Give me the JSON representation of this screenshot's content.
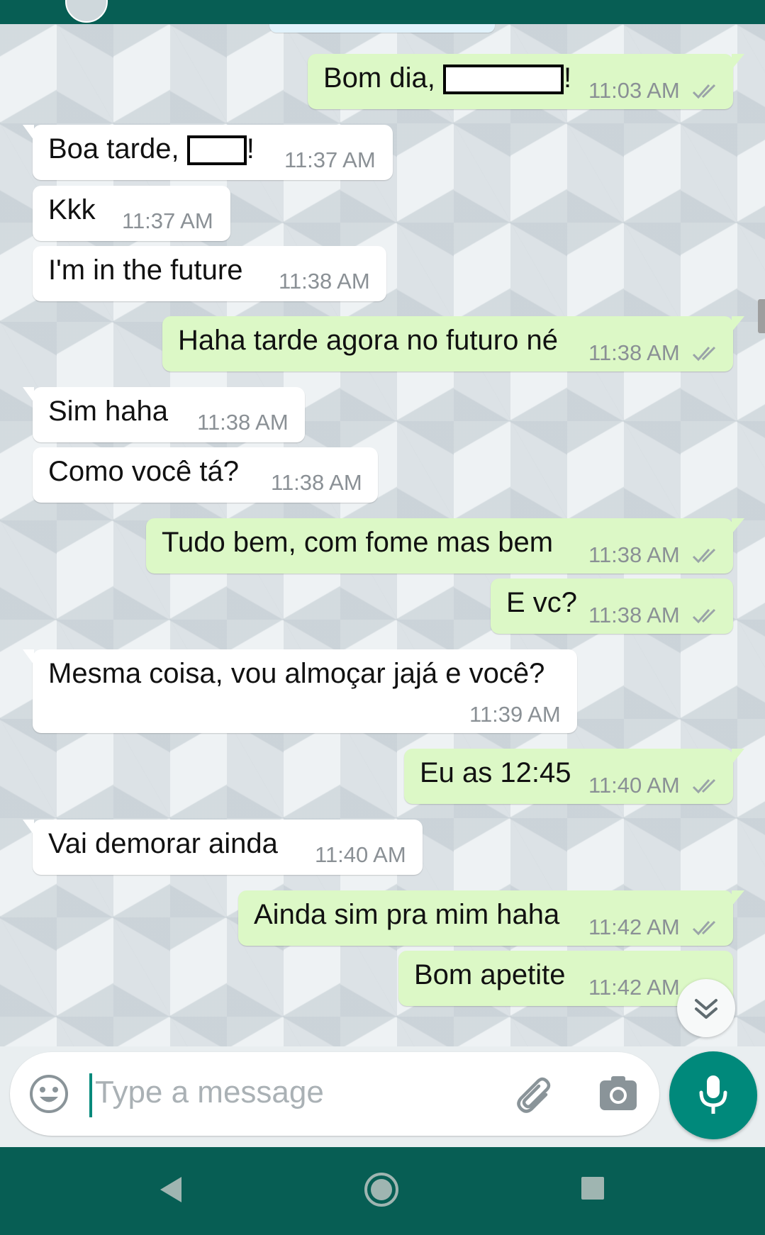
{
  "composer": {
    "placeholder": "Type a message",
    "icons": [
      "emoji-icon",
      "paperclip-icon",
      "camera-icon"
    ]
  },
  "mic_button": {
    "icon": "mic-icon"
  },
  "scroll_button": {
    "icon": "double-chevron-down-icon"
  },
  "navigation": {
    "icons": [
      "back-triangle-icon",
      "home-circle-icon",
      "recents-square-icon"
    ]
  },
  "colors": {
    "header": "#075e54",
    "outgoing_bubble": "#dcf8c6",
    "incoming_bubble": "#ffffff",
    "accent": "#00897b",
    "time_text": "#8a9095",
    "read_ticks": "#9aa3a8"
  },
  "messages": [
    {
      "direction": "out",
      "text": "Bom dia,",
      "suffix": "!",
      "redacted": true,
      "time": "11:03 AM",
      "status": "read"
    },
    {
      "direction": "in",
      "text": "Boa tarde,",
      "suffix": "!",
      "redacted": true,
      "time": "11:37 AM"
    },
    {
      "direction": "in",
      "text": "Kkk",
      "time": "11:37 AM"
    },
    {
      "direction": "in",
      "text": "I'm in the future",
      "time": "11:38 AM"
    },
    {
      "direction": "out",
      "text": "Haha tarde agora no futuro né",
      "time": "11:38 AM",
      "status": "read"
    },
    {
      "direction": "in",
      "text": "Sim haha",
      "time": "11:38 AM"
    },
    {
      "direction": "in",
      "text": "Como você tá?",
      "time": "11:38 AM"
    },
    {
      "direction": "out",
      "text": "Tudo bem, com fome mas bem",
      "time": "11:38 AM",
      "status": "read"
    },
    {
      "direction": "out",
      "text": "E vc?",
      "time": "11:38 AM",
      "status": "read"
    },
    {
      "direction": "in",
      "text": "Mesma coisa, vou almoçar jajá e você?",
      "time": "11:39 AM"
    },
    {
      "direction": "out",
      "text": "Eu as 12:45",
      "time": "11:40 AM",
      "status": "read"
    },
    {
      "direction": "in",
      "text": "Vai demorar ainda",
      "time": "11:40 AM"
    },
    {
      "direction": "out",
      "text": "Ainda sim pra mim haha",
      "time": "11:42 AM",
      "status": "read"
    },
    {
      "direction": "out",
      "text": "Bom apetite",
      "time": "11:42 AM",
      "status": "read"
    }
  ]
}
